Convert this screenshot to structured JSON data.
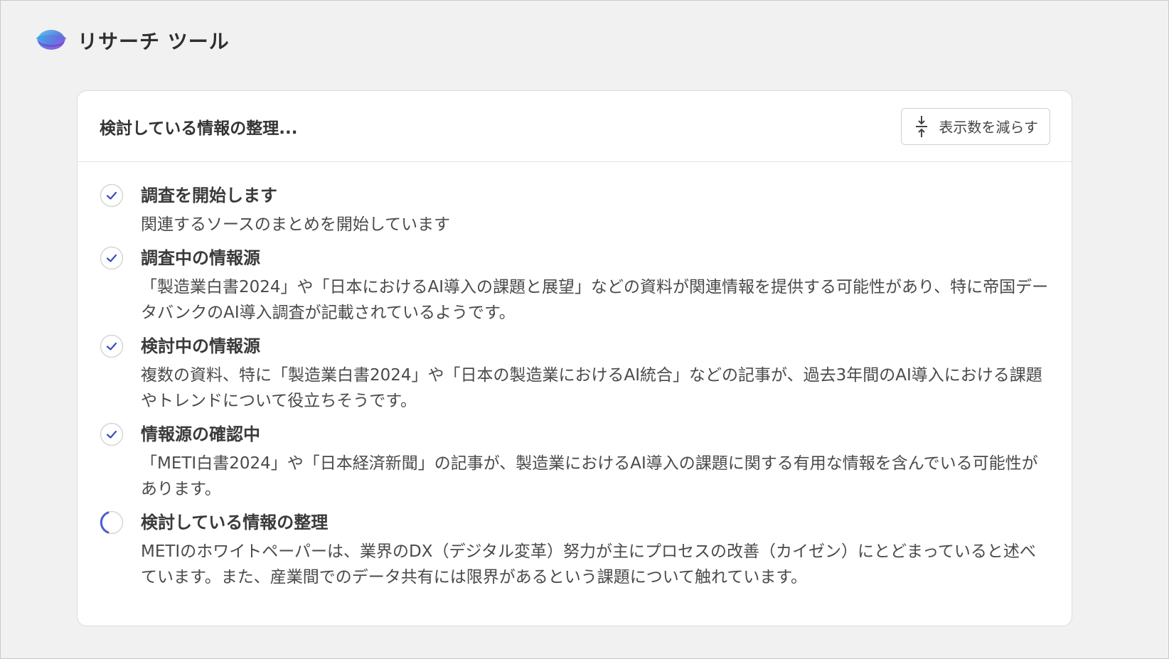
{
  "app": {
    "title": "リサーチ ツール"
  },
  "card": {
    "title": "検討している情報の整理...",
    "collapse_label": "表示数を減らす"
  },
  "steps": [
    {
      "title": "調査を開始します",
      "description": "関連するソースのまとめを開始しています",
      "status": "done"
    },
    {
      "title": "調査中の情報源",
      "description": "「製造業白書2024」や「日本におけるAI導入の課題と展望」などの資料が関連情報を提供する可能性があり、特に帝国データバンクのAI導入調査が記載されているようです。",
      "status": "done"
    },
    {
      "title": "検討中の情報源",
      "description": "複数の資料、特に「製造業白書2024」や「日本の製造業におけるAI統合」などの記事が、過去3年間のAI導入における課題やトレンドについて役立ちそうです。",
      "status": "done"
    },
    {
      "title": "情報源の確認中",
      "description": "「METI白書2024」や「日本経済新聞」の記事が、製造業におけるAI導入の課題に関する有用な情報を含んでいる可能性があります。",
      "status": "done"
    },
    {
      "title": "検討している情報の整理",
      "description": "METIのホワイトペーパーは、業界のDX（デジタル変革）努力が主にプロセスの改善（カイゼン）にとどまっていると述べています。また、産業間でのデータ共有には限界があるという課題について触れています。",
      "status": "in-progress"
    }
  ],
  "colors": {
    "check": "#3b4cc0",
    "spinner": "#4d5bd6",
    "logo_top": "#4fb8e8",
    "logo_bottom": "#9b4fd6"
  }
}
